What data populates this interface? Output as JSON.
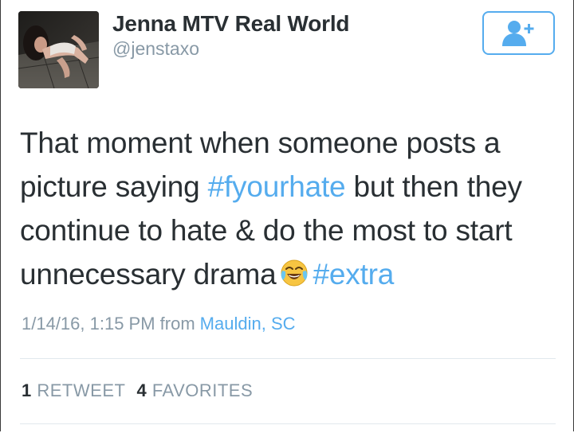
{
  "user": {
    "display_name": "Jenna MTV Real World",
    "handle": "@jenstaxo",
    "avatar_icon": "profile-photo",
    "follow_icon": "follow-person-plus-icon"
  },
  "tweet": {
    "line1": "That moment when someone posts a",
    "line2_pre": "picture saying ",
    "hashtag1": "#fyourhate",
    "line2_post": " but then they",
    "line3": "continue to hate & do the most to start",
    "line4_pre": "unnecessary drama",
    "emoji": "face-with-tears-of-joy",
    "hashtag2": "#extra"
  },
  "meta": {
    "timestamp": "1/14/16, 1:15 PM from",
    "location": "Mauldin, SC"
  },
  "stats": {
    "retweets_count": "1",
    "retweets_label": "RETWEET",
    "favorites_count": "4",
    "favorites_label": "FAVORITES"
  },
  "colors": {
    "link": "#55acee",
    "text": "#292f33",
    "secondary": "#8899a6",
    "divider": "#e1e8ed"
  }
}
